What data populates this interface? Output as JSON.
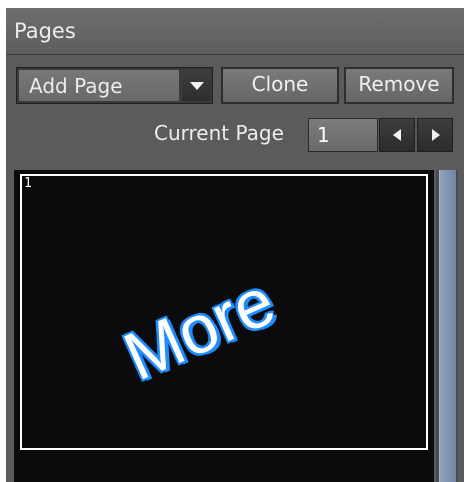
{
  "panel": {
    "title": "Pages"
  },
  "toolbar": {
    "add_page_label": "Add Page",
    "clone_label": "Clone",
    "remove_label": "Remove"
  },
  "navigator": {
    "current_page_label": "Current Page",
    "current_page_value": "1"
  },
  "thumbnail": {
    "page_number": "1",
    "text": "More"
  },
  "icons": {
    "dropdown": "chevron-down-icon",
    "prev": "chevron-left-icon",
    "next": "chevron-right-icon"
  },
  "colors": {
    "panel_bg": "#5b5b5b",
    "thumb_bg": "#0b0b0b",
    "text_glow": "#1f8dff",
    "scroll_thumb": "#7f95b3"
  }
}
